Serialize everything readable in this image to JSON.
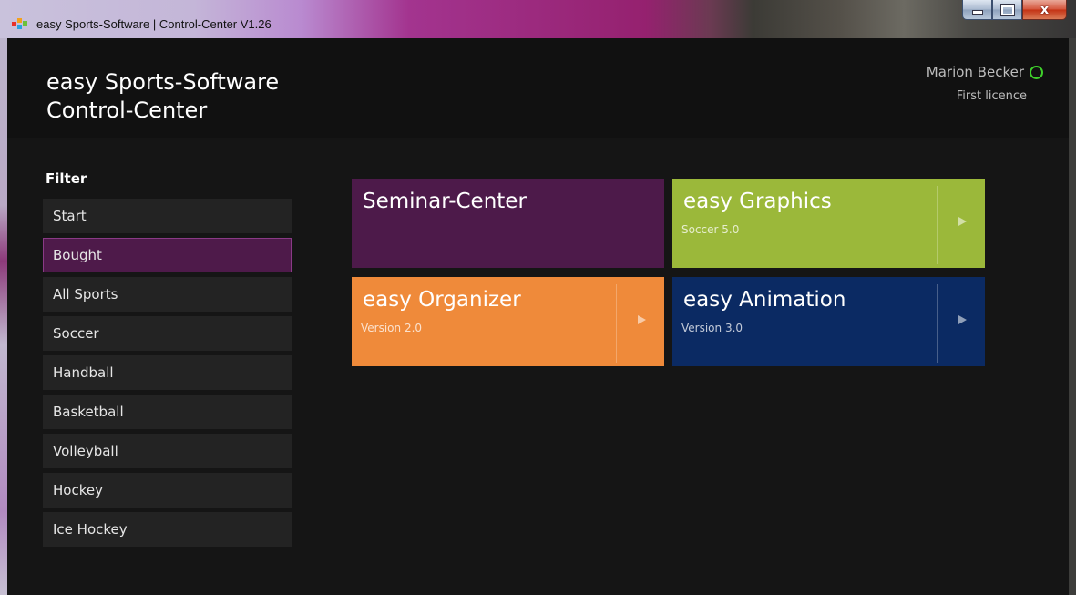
{
  "window": {
    "title": "easy Sports-Software | Control-Center V1.26",
    "buttons": {
      "minimize": "minimize",
      "maximize": "maximize",
      "close": "x"
    }
  },
  "header": {
    "brand_line1": "easy Sports-Software",
    "brand_line2": "Control-Center",
    "user_name": "Marion Becker",
    "licence": "First licence",
    "status_color": "#3fd02b"
  },
  "sidebar": {
    "title": "Filter",
    "items": [
      {
        "label": "Start"
      },
      {
        "label": "Bought",
        "selected": true
      },
      {
        "label": "All Sports"
      },
      {
        "label": "Soccer"
      },
      {
        "label": "Handball"
      },
      {
        "label": "Basketball"
      },
      {
        "label": "Volleyball"
      },
      {
        "label": "Hockey"
      },
      {
        "label": "Ice Hockey"
      }
    ]
  },
  "tiles": [
    {
      "title": "Seminar-Center",
      "subtitle": "",
      "color": "#4d1a4a"
    },
    {
      "title": "easy Graphics",
      "subtitle": "Soccer 5.0",
      "color": "#9bb83a"
    },
    {
      "title": "easy Organizer",
      "subtitle": "Version 2.0",
      "color": "#ef8a3a"
    },
    {
      "title": "easy Animation",
      "subtitle": "Version 3.0",
      "color": "#0b2a63"
    }
  ],
  "icons": {
    "app": "app-logo-icon",
    "play": "play-arrow-icon",
    "status": "online-status-icon"
  }
}
